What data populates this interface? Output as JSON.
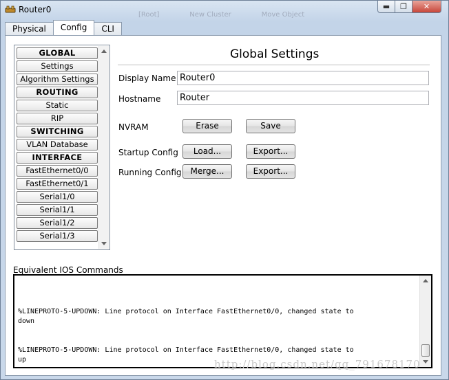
{
  "window": {
    "title": "Router0",
    "ghost_tabs": [
      "[Root]",
      "New Cluster",
      "Move Object"
    ],
    "min_glyph": "▬",
    "max_glyph": "❐",
    "close_glyph": "✕"
  },
  "tabs": [
    "Physical",
    "Config",
    "CLI"
  ],
  "active_tab": "Config",
  "sidebar": {
    "items": [
      {
        "label": "GLOBAL",
        "header": true
      },
      {
        "label": "Settings",
        "header": false
      },
      {
        "label": "Algorithm Settings",
        "header": false
      },
      {
        "label": "ROUTING",
        "header": true
      },
      {
        "label": "Static",
        "header": false
      },
      {
        "label": "RIP",
        "header": false
      },
      {
        "label": "SWITCHING",
        "header": true
      },
      {
        "label": "VLAN Database",
        "header": false
      },
      {
        "label": "INTERFACE",
        "header": true
      },
      {
        "label": "FastEthernet0/0",
        "header": false
      },
      {
        "label": "FastEthernet0/1",
        "header": false
      },
      {
        "label": "Serial1/0",
        "header": false
      },
      {
        "label": "Serial1/1",
        "header": false
      },
      {
        "label": "Serial1/2",
        "header": false
      },
      {
        "label": "Serial1/3",
        "header": false
      }
    ]
  },
  "global_settings": {
    "title": "Global Settings",
    "display_name_label": "Display Name",
    "display_name_value": "Router0",
    "hostname_label": "Hostname",
    "hostname_value": "Router",
    "nvram_label": "NVRAM",
    "erase_label": "Erase",
    "save_label": "Save",
    "startup_label": "Startup Config",
    "load_label": "Load...",
    "startup_export_label": "Export...",
    "running_label": "Running Config",
    "merge_label": "Merge...",
    "running_export_label": "Export..."
  },
  "ios": {
    "label": "Equivalent IOS Commands",
    "text": "%LINEPROTO-5-UPDOWN: Line protocol on Interface FastEthernet0/0, changed state to\ndown\n\n\n%LINEPROTO-5-UPDOWN: Line protocol on Interface FastEthernet0/0, changed state to\nup"
  },
  "watermark": "http://blog.csdn.net/qq_791678170"
}
